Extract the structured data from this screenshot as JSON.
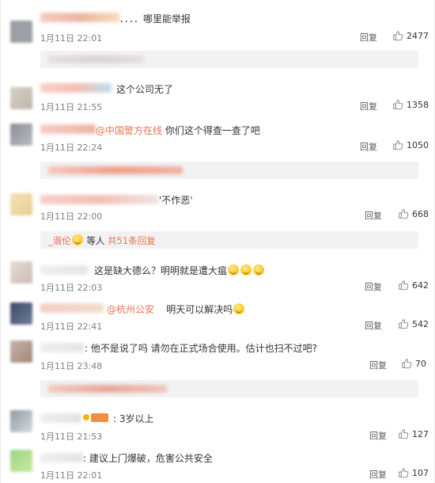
{
  "comments": [
    {
      "text": "．．．．哪里能举报",
      "time": "1月11日 22:01",
      "reply": "回复",
      "likes": "2477"
    },
    {
      "text": "这个公司无了",
      "time": "1月11日 21:55",
      "reply": "回复",
      "likes": "1358"
    },
    {
      "mention": "@中国警方在线",
      "text": "你们这个得查一查了吧",
      "time": "1月11日 22:24",
      "reply": "回复",
      "likes": "1050"
    },
    {
      "text": "'不作恶'",
      "time": "1月11日 22:00",
      "reply": "回复",
      "likes": "668"
    },
    {
      "text": "这是缺大德么？明明就是遭大瘟",
      "time": "1月11日 22:03",
      "reply": "回复",
      "likes": "642"
    },
    {
      "mention": "@杭州公安",
      "text": "明天可以解决吗",
      "time": "1月11日 22:41",
      "reply": "回复",
      "likes": "542"
    },
    {
      "text": ": 他不是说了吗 请勿在正式场合使用。估计也扫不过吧?",
      "time": "1月11日 23:48",
      "reply": "回复",
      "likes": "70"
    },
    {
      "text": ": 3岁以上",
      "time": "1月11日 21:53",
      "reply": "回复",
      "likes": "127"
    },
    {
      "text": ": 建议上门爆破，危害公共安全",
      "time": "1月11日 22:01",
      "reply": "回复",
      "likes": "107"
    }
  ],
  "subreply": {
    "user": "_谐伦",
    "mid": "等人",
    "count": "共51条回复"
  },
  "colors": {
    "accent": "#eb7350",
    "subbox": "#f2f2f5"
  }
}
